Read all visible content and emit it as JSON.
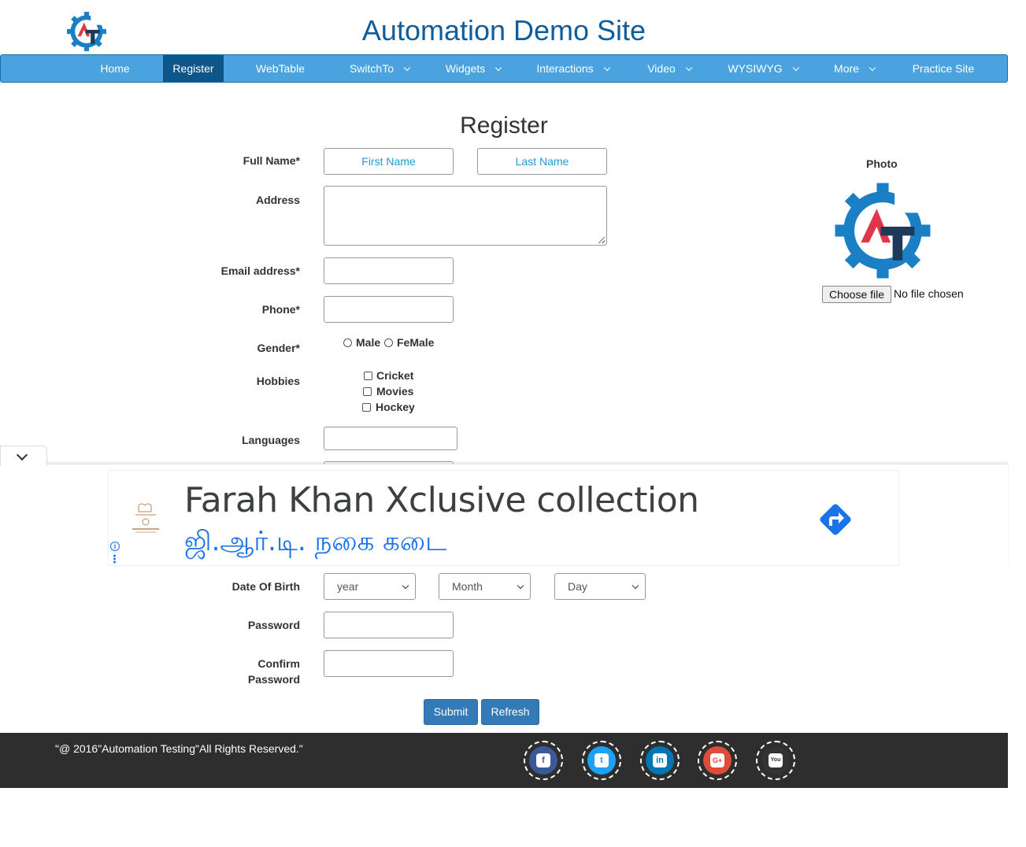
{
  "header": {
    "title": "Automation Demo Site",
    "logo_icon": "automation-testing-gear-logo"
  },
  "nav": {
    "items": [
      {
        "label": "Home"
      },
      {
        "label": "Register"
      },
      {
        "label": "WebTable"
      },
      {
        "label": "SwitchTo"
      },
      {
        "label": "Widgets"
      },
      {
        "label": "Interactions"
      },
      {
        "label": "Video"
      },
      {
        "label": "WYSIWYG"
      },
      {
        "label": "More"
      },
      {
        "label": "Practice Site"
      }
    ],
    "active": "Register",
    "colors": {
      "bar": "#4aa3df",
      "active": "#0d5689"
    }
  },
  "form": {
    "title": "Register",
    "full_name_label": "Full Name*",
    "first_name_placeholder": "First Name",
    "last_name_placeholder": "Last Name",
    "address_label": "Address",
    "email_label": "Email address*",
    "phone_label": "Phone*",
    "gender_label": "Gender*",
    "gender_options": [
      "Male",
      "FeMale"
    ],
    "hobbies_label": "Hobbies",
    "hobbies": [
      "Cricket",
      "Movies",
      "Hockey"
    ],
    "languages_label": "Languages",
    "dob_label": "Date Of Birth",
    "dob_year": "year",
    "dob_month": "Month",
    "dob_day": "Day",
    "password_label": "Password",
    "confirm_password_label_1": "Confirm",
    "confirm_password_label_2": "Password",
    "submit_label": "Submit",
    "refresh_label": "Refresh"
  },
  "photo": {
    "label": "Photo",
    "choose_file_label": "Choose file",
    "file_status": "No file chosen"
  },
  "ad": {
    "headline": "Farah Khan Xclusive collection",
    "subline": "ஜி.ஆர்.டி. நகை கடை",
    "info_glyph": "i",
    "colors": {
      "headline": "#3c4043",
      "subline": "#1a73e8",
      "direction": "#1a73e8"
    }
  },
  "footer": {
    "copyright": "\"@ 2016\"Automation Testing\"All Rights Reserved.\"",
    "social": [
      {
        "name": "facebook-icon",
        "glyph": "f",
        "color": "#3b5998"
      },
      {
        "name": "twitter-icon",
        "glyph": "t",
        "color": "#1da1f2"
      },
      {
        "name": "linkedin-icon",
        "glyph": "in",
        "color": "#0077b5"
      },
      {
        "name": "google-plus-icon",
        "glyph": "G+",
        "color": "#dd4b39"
      },
      {
        "name": "youtube-icon",
        "glyph": "You",
        "color": "#333333"
      }
    ]
  }
}
